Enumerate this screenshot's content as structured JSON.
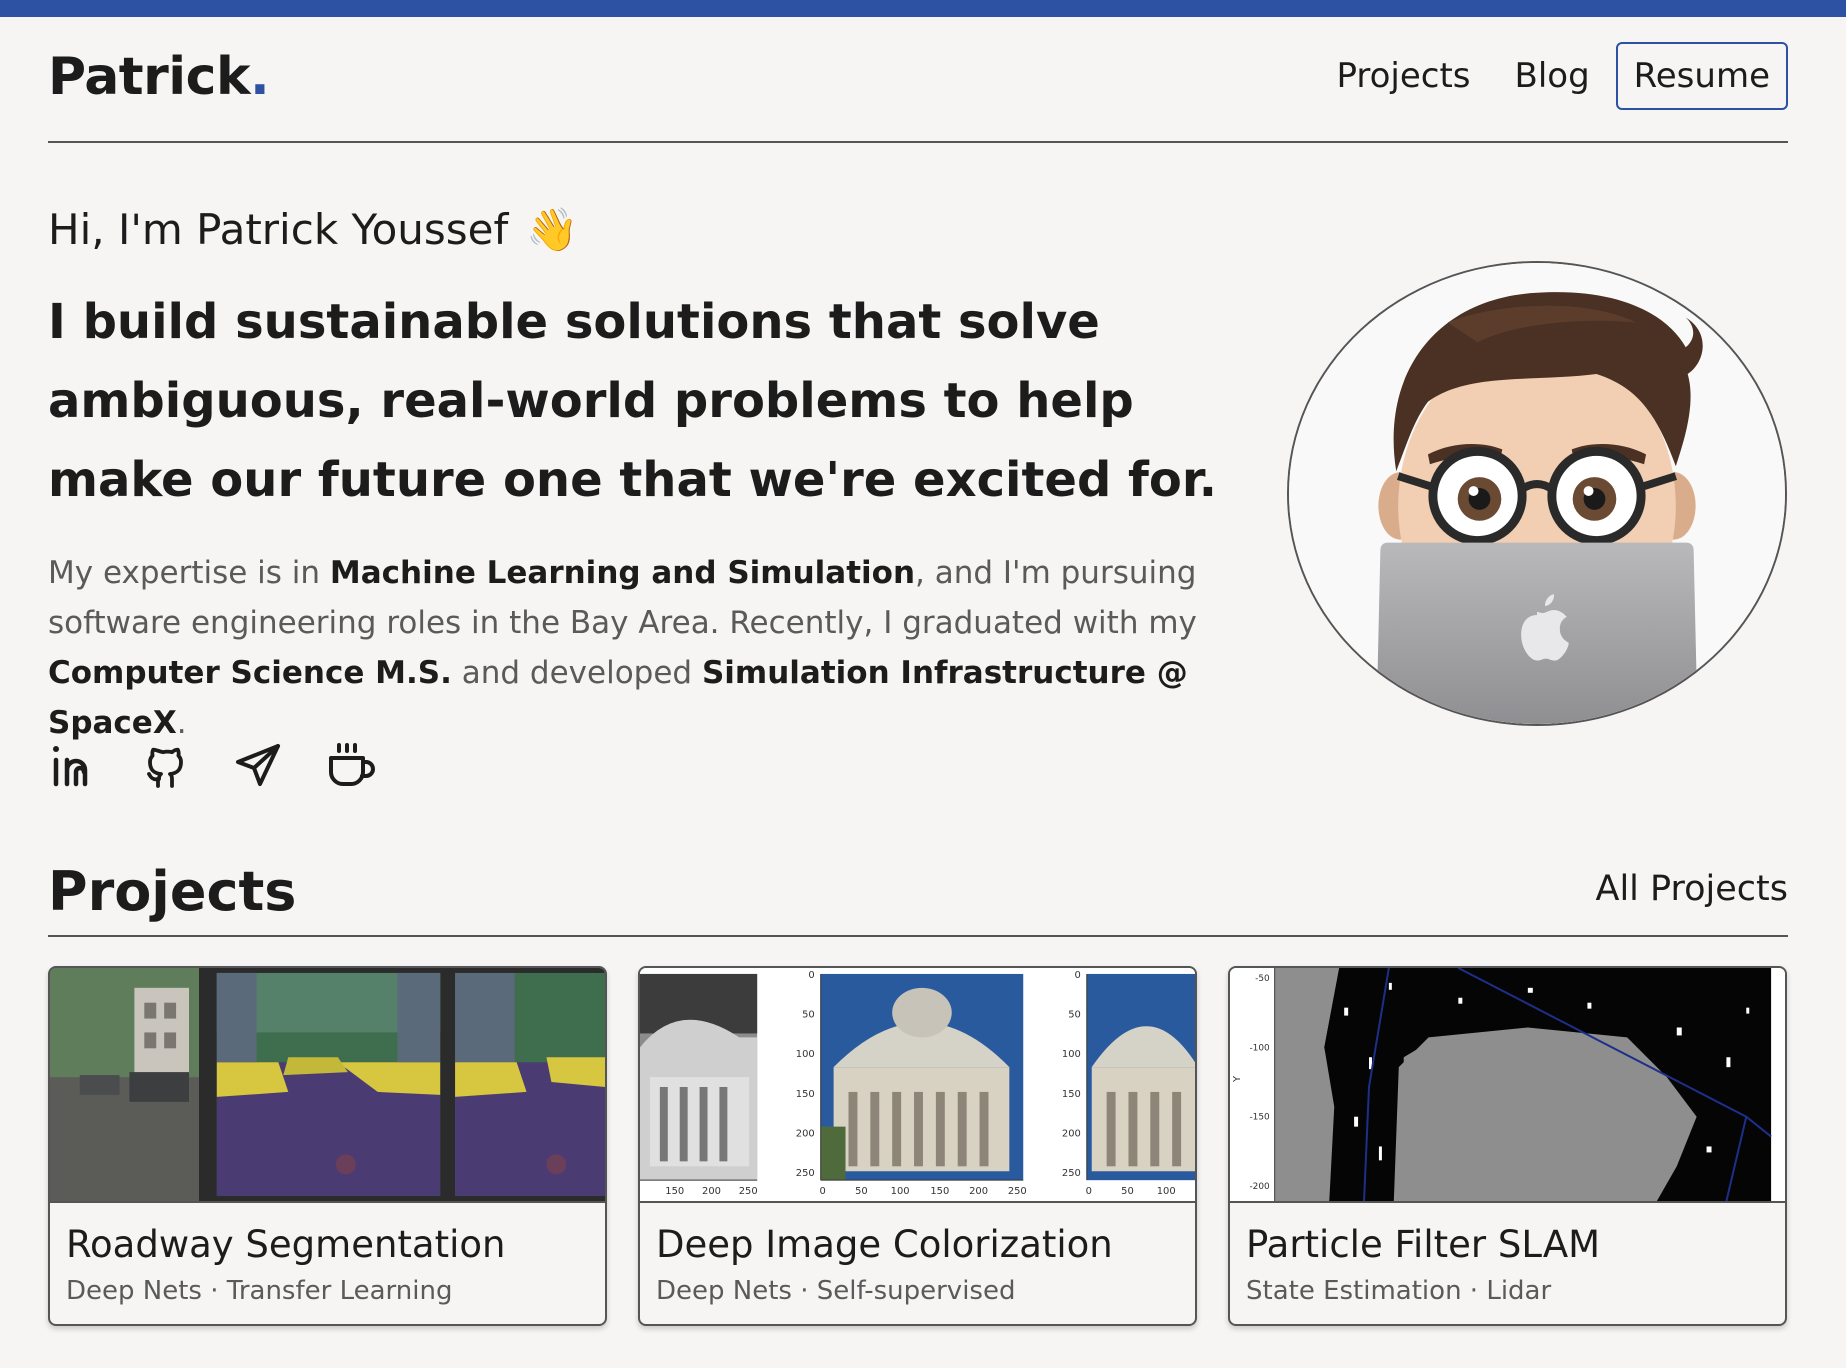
{
  "header": {
    "logo_text": "Patrick",
    "logo_dot": ".",
    "nav": {
      "projects": "Projects",
      "blog": "Blog",
      "resume": "Resume"
    }
  },
  "hero": {
    "greeting": "Hi, I'm Patrick Youssef",
    "wave": "👋",
    "headline": "I build sustainable solutions that solve ambiguous, real-world problems to help make our future one that we're excited for.",
    "bio": {
      "t1": "My expertise is in ",
      "b1": "Machine Learning and Simulation",
      "t2": ", and I'm pursuing software engineering roles in the Bay Area. Recently, I graduated with my ",
      "b2": "Computer Science M.S.",
      "t3": " and developed ",
      "b3": "Simulation Infrastructure @ SpaceX",
      "t4": "."
    }
  },
  "socials": [
    "linkedin-icon",
    "github-icon",
    "send-icon",
    "coffee-icon"
  ],
  "projects": {
    "title": "Projects",
    "all_link": "All Projects",
    "cards": [
      {
        "title": "Roadway Segmentation",
        "tags": "Deep Nets · Transfer Learning"
      },
      {
        "title": "Deep Image Colorization",
        "tags": "Deep Nets · Self-supervised"
      },
      {
        "title": "Particle Filter SLAM",
        "tags": "State Estimation · Lidar"
      }
    ],
    "colorization_ticks": {
      "y": [
        "0",
        "50",
        "100",
        "150",
        "200",
        "250"
      ],
      "x_left": [
        "150",
        "200",
        "250"
      ],
      "x_mid": [
        "0",
        "50",
        "100",
        "150",
        "200",
        "250"
      ],
      "x_right": [
        "0",
        "50",
        "100"
      ]
    },
    "slam_ticks": {
      "y": [
        "-50",
        "-100",
        "-150",
        "-200"
      ],
      "ylabel": "Y"
    }
  },
  "colors": {
    "accent": "#2d52a3",
    "background": "#f6f5f4",
    "text": "#1c1c1c",
    "muted": "#5a5a5a"
  }
}
